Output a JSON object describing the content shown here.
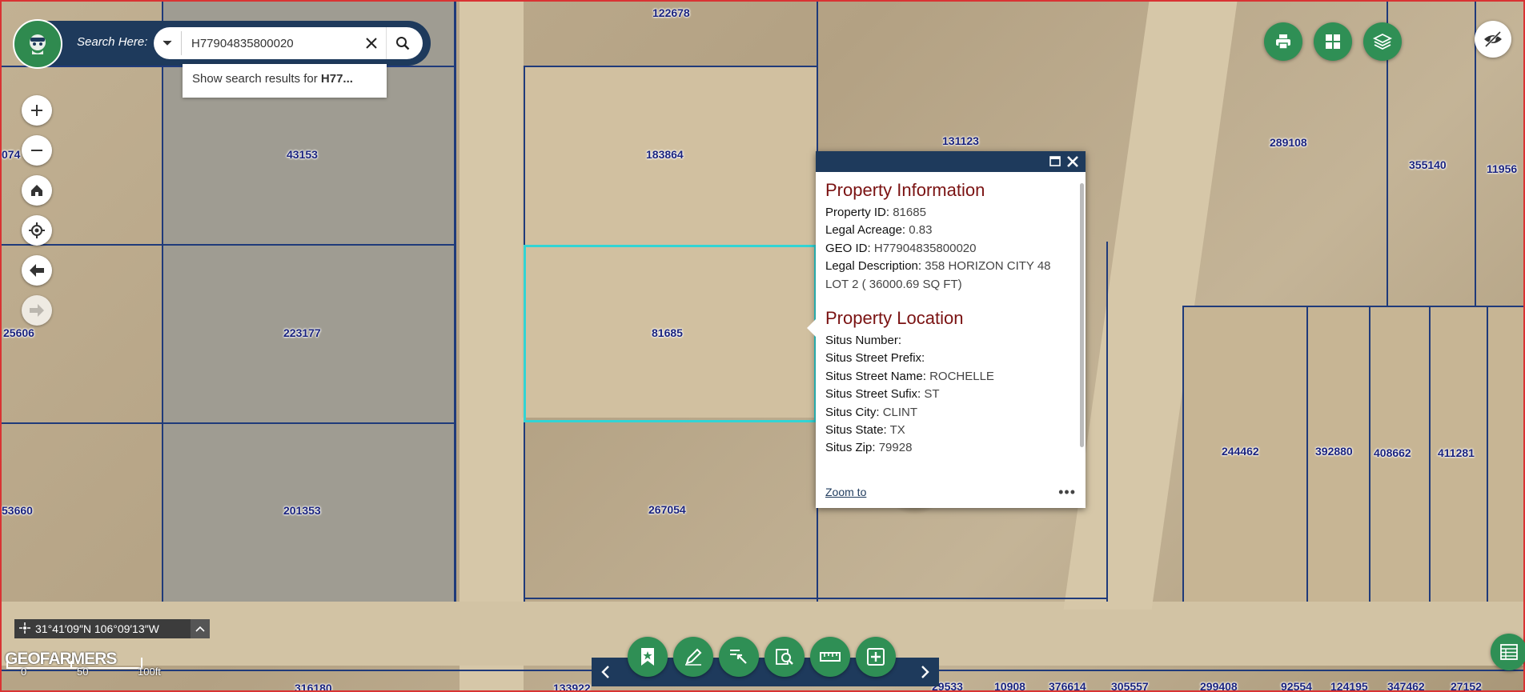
{
  "search": {
    "label": "Search Here:",
    "value": "H77904835800020",
    "suggestion_prefix": "Show search results for ",
    "suggestion_term": "H77..."
  },
  "map": {
    "parcels": [
      "122678",
      "183864",
      "131123",
      "289108",
      "355140",
      "11956",
      "43153",
      "074",
      "223177",
      "25606",
      "81685",
      "244462",
      "392880",
      "408662",
      "411281",
      "53660",
      "201353",
      "267054",
      "316180",
      "133922",
      "29533",
      "10908",
      "376614",
      "305557",
      "299408",
      "92554",
      "124195",
      "347462",
      "27152"
    ]
  },
  "popup": {
    "info_title": "Property Information",
    "info_rows": [
      {
        "key": "Property ID:",
        "value": "81685"
      },
      {
        "key": "Legal Acreage:",
        "value": "0.83"
      },
      {
        "key": "GEO ID:",
        "value": "H77904835800020"
      },
      {
        "key": "Legal Description:",
        "value": "358 HORIZON CITY 48 LOT 2 ( 36000.69 SQ FT)"
      }
    ],
    "location_title": "Property Location",
    "location_rows": [
      {
        "key": "Situs Number:",
        "value": ""
      },
      {
        "key": "Situs Street Prefix:",
        "value": ""
      },
      {
        "key": "Situs Street Name:",
        "value": "ROCHELLE"
      },
      {
        "key": "Situs Street Sufix:",
        "value": "ST"
      },
      {
        "key": "Situs City:",
        "value": "CLINT"
      },
      {
        "key": "Situs State:",
        "value": "TX"
      },
      {
        "key": "Situs Zip:",
        "value": "79928"
      }
    ],
    "zoom_label": "Zoom to",
    "more_label": "•••"
  },
  "coords": {
    "text": "31°41′09″N 106°09′13″W"
  },
  "attribution": "GEOFARMERS",
  "scale": {
    "zero": "0",
    "mid": "50",
    "end": "100ft"
  },
  "colors": {
    "brand_dark": "#1e3a5c",
    "brand_green": "#2f8f55",
    "title_red": "#7a1212",
    "selection": "#32d4d4"
  }
}
